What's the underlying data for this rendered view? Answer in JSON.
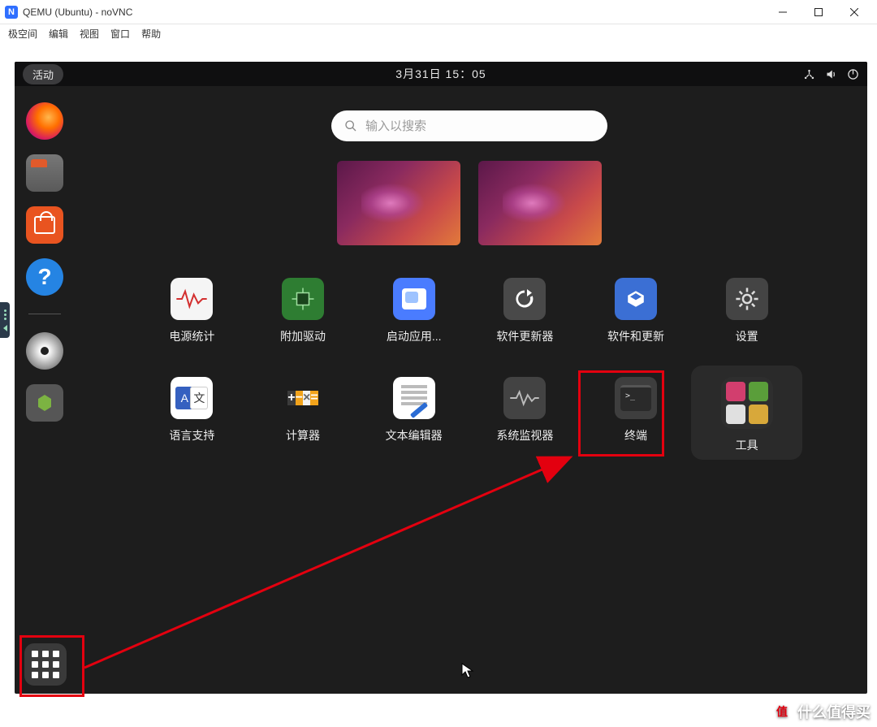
{
  "window": {
    "title": "QEMU (Ubuntu) - noVNC"
  },
  "menu": {
    "items": [
      "极空间",
      "编辑",
      "视图",
      "窗口",
      "帮助"
    ]
  },
  "gnome": {
    "activities": "活动",
    "clock": "3月31日  15：05"
  },
  "search": {
    "placeholder": "输入以搜索"
  },
  "dock": {
    "items": [
      "firefox",
      "files",
      "software-store",
      "help",
      "disk",
      "trash"
    ]
  },
  "apps": {
    "row1": [
      {
        "id": "power-statistics",
        "label": "电源统计"
      },
      {
        "id": "additional-drivers",
        "label": "附加驱动"
      },
      {
        "id": "startup-apps",
        "label": "启动应用..."
      },
      {
        "id": "software-updater",
        "label": "软件更新器"
      },
      {
        "id": "software-sources",
        "label": "软件和更新"
      },
      {
        "id": "settings",
        "label": "设置"
      }
    ],
    "row2": [
      {
        "id": "language-support",
        "label": "语言支持"
      },
      {
        "id": "calculator",
        "label": "计算器"
      },
      {
        "id": "text-editor",
        "label": "文本编辑器"
      },
      {
        "id": "system-monitor",
        "label": "系统监视器"
      },
      {
        "id": "terminal",
        "label": "终端"
      },
      {
        "id": "tools-folder",
        "label": "工具"
      }
    ]
  },
  "lang_icon": {
    "left": "A",
    "right": "文"
  },
  "calc_icon": {
    "a": "+",
    "b": "−",
    "c": "×",
    "d": "="
  },
  "watermark": {
    "badge": "值",
    "text": "什么值得买"
  }
}
